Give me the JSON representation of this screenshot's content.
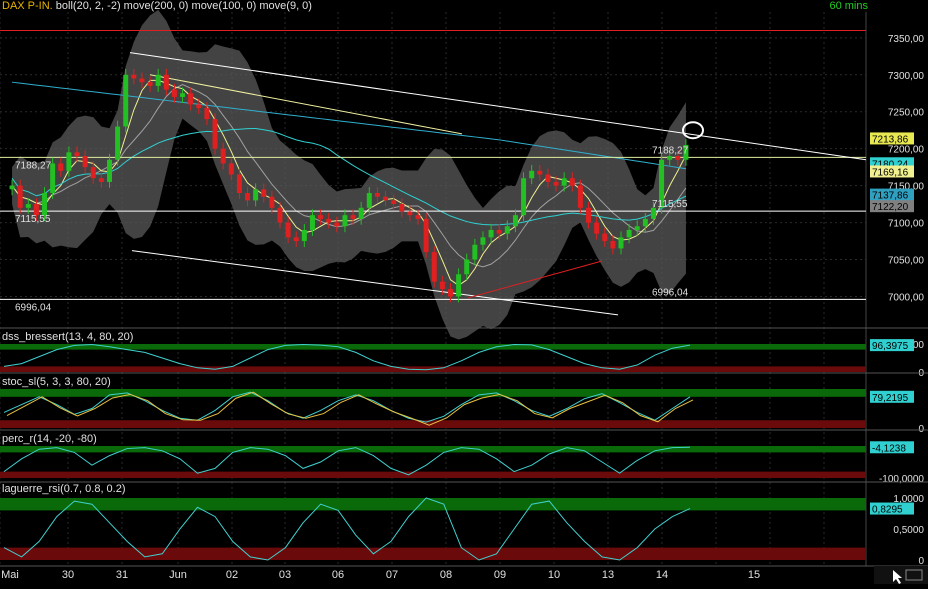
{
  "header": {
    "symbol": "DAX P-IN.",
    "indicators": "boll(20, 2, -2) move(200, 0) move(100, 0) move(9, 0)",
    "interval": "60 mins"
  },
  "chart_data": [
    {
      "type": "candlestick",
      "title": "DAX P-IN.",
      "ylim": [
        6960,
        7385
      ],
      "y_ticks": [
        "7350,00",
        "7300,00",
        "7250,00",
        "7200,00",
        "7150,00",
        "7100,00",
        "7050,00",
        "7000,00"
      ],
      "x_labels": [
        "Mai",
        "30",
        "31",
        "Jun",
        "02",
        "03",
        "06",
        "07",
        "08",
        "09",
        "10",
        "13",
        "14",
        "15"
      ],
      "price_labels_axis": [
        {
          "text": "7213,86",
          "value": 7213.86,
          "bg": "#e8e850",
          "fg": "#000000"
        },
        {
          "text": "7180,24",
          "value": 7180.24,
          "bg": "#30d0d0",
          "fg": "#000000"
        },
        {
          "text": "7169,16",
          "value": 7169.16,
          "bg": "#f0f090",
          "fg": "#000000"
        },
        {
          "text": "7137,86",
          "value": 7137.86,
          "bg": "#30a0c0",
          "fg": "#000000"
        },
        {
          "text": "7122,20",
          "value": 7122.2,
          "bg": "#808080",
          "fg": "#000000"
        }
      ],
      "horizontal_lines": [
        {
          "value": 7360,
          "color": "#e02020"
        },
        {
          "value": 7188.27,
          "color": "#e0f0a0"
        },
        {
          "value": 7115.55,
          "color": "#ffffff"
        },
        {
          "value": 6996.04,
          "color": "#ffffff"
        }
      ],
      "level_labels": [
        {
          "text": "7188,27",
          "value": 7188.27
        },
        {
          "text": "7188,27",
          "value": 7188.27
        },
        {
          "text": "7115,55",
          "value": 7115.55
        },
        {
          "text": "7115,55",
          "value": 7115.55
        },
        {
          "text": "6996,04",
          "value": 6996.04
        },
        {
          "text": "6996,04",
          "value": 6996.04
        }
      ],
      "close_series": [
        7150,
        7120,
        7125,
        7110,
        7140,
        7180,
        7170,
        7195,
        7190,
        7175,
        7160,
        7155,
        7185,
        7230,
        7300,
        7295,
        7290,
        7285,
        7300,
        7280,
        7270,
        7275,
        7260,
        7255,
        7240,
        7200,
        7180,
        7165,
        7140,
        7130,
        7145,
        7135,
        7120,
        7100,
        7080,
        7075,
        7090,
        7110,
        7105,
        7100,
        7095,
        7110,
        7105,
        7120,
        7140,
        7135,
        7130,
        7125,
        7115,
        7110,
        7105,
        7060,
        7020,
        7010,
        7000,
        7030,
        7050,
        7070,
        7080,
        7090,
        7085,
        7095,
        7110,
        7160,
        7170,
        7165,
        7155,
        7150,
        7160,
        7150,
        7120,
        7100,
        7085,
        7075,
        7065,
        7080,
        7090,
        7095,
        7105,
        7120,
        7185,
        7190,
        7185,
        7205
      ]
    },
    {
      "type": "line",
      "title": "dss_bressert(13, 4, 80, 20)",
      "y_ticks": [
        "100",
        "0"
      ],
      "current_value_label": "96,3975",
      "ylim": [
        0,
        100
      ],
      "values": [
        20,
        30,
        55,
        80,
        95,
        98,
        90,
        80,
        70,
        50,
        30,
        15,
        10,
        20,
        50,
        80,
        95,
        98,
        96,
        90,
        70,
        40,
        20,
        10,
        8,
        15,
        40,
        70,
        90,
        98,
        97,
        80,
        55,
        30,
        15,
        10,
        25,
        60,
        85,
        96
      ]
    },
    {
      "type": "line",
      "title": "stoc_sl(5, 3, 3, 80, 20)",
      "y_ticks": [
        "0"
      ],
      "current_value_label": "79,2195",
      "ylim": [
        0,
        100
      ],
      "values": [
        40,
        60,
        80,
        60,
        35,
        50,
        85,
        90,
        70,
        45,
        25,
        20,
        45,
        80,
        92,
        70,
        40,
        25,
        45,
        70,
        85,
        70,
        45,
        25,
        15,
        30,
        60,
        85,
        90,
        70,
        45,
        30,
        50,
        75,
        88,
        65,
        40,
        20,
        50,
        80
      ]
    },
    {
      "type": "line",
      "title": "perc_r(14, -20, -80)",
      "y_ticks": [
        "-100,0000"
      ],
      "current_value_label": "-4,1238",
      "ylim": [
        -100,
        0
      ],
      "values": [
        -80,
        -40,
        -10,
        -5,
        -20,
        -60,
        -30,
        -8,
        -5,
        -15,
        -40,
        -85,
        -70,
        -20,
        -5,
        -10,
        -30,
        -70,
        -50,
        -15,
        -5,
        -30,
        -70,
        -90,
        -60,
        -20,
        -5,
        -10,
        -40,
        -80,
        -60,
        -25,
        -5,
        -15,
        -50,
        -85,
        -45,
        -15,
        -5,
        -4
      ]
    },
    {
      "type": "line",
      "title": "laguerre_rsi(0.7, 0.8, 0.2)",
      "y_ticks": [
        "1,0000",
        "0,5000",
        "0"
      ],
      "current_value_label": "0,8295",
      "ylim": [
        0,
        1
      ],
      "values": [
        0.2,
        0.05,
        0.3,
        0.7,
        0.95,
        0.9,
        0.6,
        0.3,
        0.05,
        0.1,
        0.5,
        0.85,
        0.7,
        0.3,
        0.05,
        0.0,
        0.2,
        0.6,
        0.9,
        0.8,
        0.4,
        0.1,
        0.3,
        0.7,
        1.0,
        0.9,
        0.2,
        0.0,
        0.1,
        0.5,
        0.9,
        0.95,
        0.6,
        0.3,
        0.05,
        0.0,
        0.2,
        0.5,
        0.7,
        0.83
      ]
    }
  ],
  "colors": {
    "background": "#000000",
    "grid": "#2a2a2a",
    "bull": "#22c022",
    "bear": "#e02020",
    "bollinger_fill": "#5a5a5a",
    "ma200": "#30b0d0",
    "ma100": "#30d0d0",
    "ma9": "#f0f090",
    "zone_green": "#0a6a0a",
    "zone_red": "#6a0a0a"
  },
  "icons": [
    "cursor-icon"
  ]
}
